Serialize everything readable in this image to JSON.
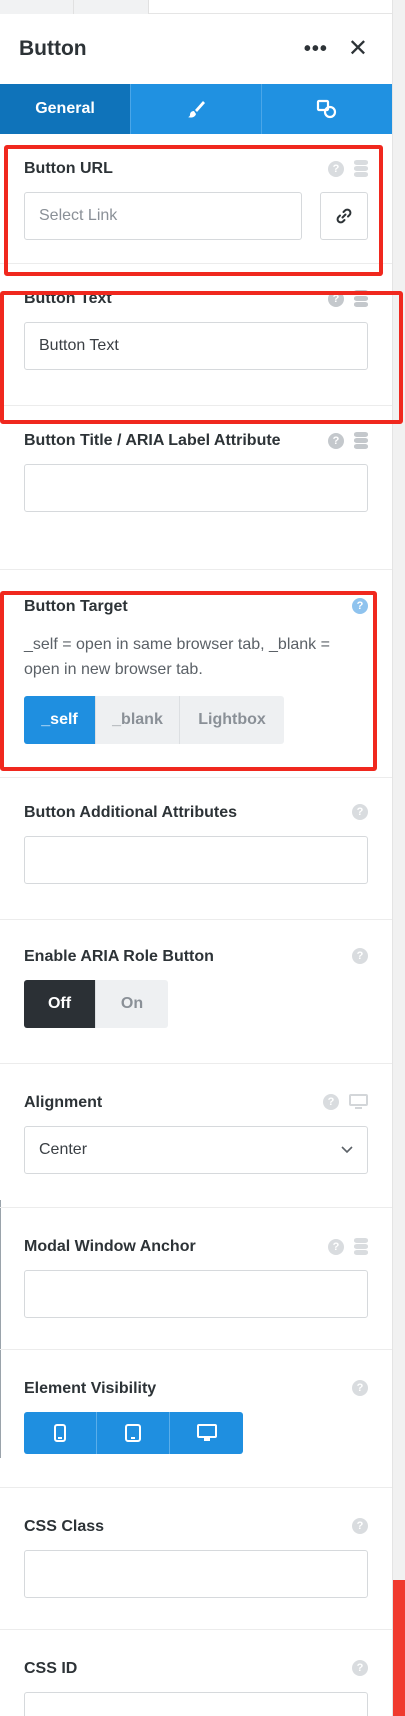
{
  "panel": {
    "title": "Button",
    "more_icon": "more-horizontal-icon",
    "close_icon": "close-icon"
  },
  "tabs": [
    {
      "label": "General",
      "active": true
    },
    {
      "icon": "brush-icon",
      "label": ""
    },
    {
      "icon": "shapes-icon",
      "label": ""
    }
  ],
  "fields": {
    "button_url": {
      "label": "Button URL",
      "placeholder": "Select Link",
      "value": ""
    },
    "button_text": {
      "label": "Button Text",
      "value": "Button Text"
    },
    "button_title": {
      "label": "Button Title / ARIA Label Attribute",
      "value": ""
    },
    "button_target": {
      "label": "Button Target",
      "description": "_self = open in same browser tab, _blank = open in new browser tab.",
      "options": [
        "_self",
        "_blank",
        "Lightbox"
      ],
      "selected": "_self"
    },
    "button_additional": {
      "label": "Button Additional Attributes",
      "value": ""
    },
    "aria_role": {
      "label": "Enable ARIA Role Button",
      "options": [
        "Off",
        "On"
      ],
      "selected": "Off"
    },
    "alignment": {
      "label": "Alignment",
      "value": "Center"
    },
    "modal_anchor": {
      "label": "Modal Window Anchor",
      "value": ""
    },
    "visibility": {
      "label": "Element Visibility",
      "devices": [
        "mobile-icon",
        "tablet-icon",
        "desktop-icon"
      ]
    },
    "css_class": {
      "label": "CSS Class",
      "value": ""
    },
    "css_id": {
      "label": "CSS ID",
      "value": ""
    }
  },
  "colors": {
    "accent": "#1f8fe0",
    "tab_active": "#0f73ba",
    "highlight": "#f0281e"
  }
}
